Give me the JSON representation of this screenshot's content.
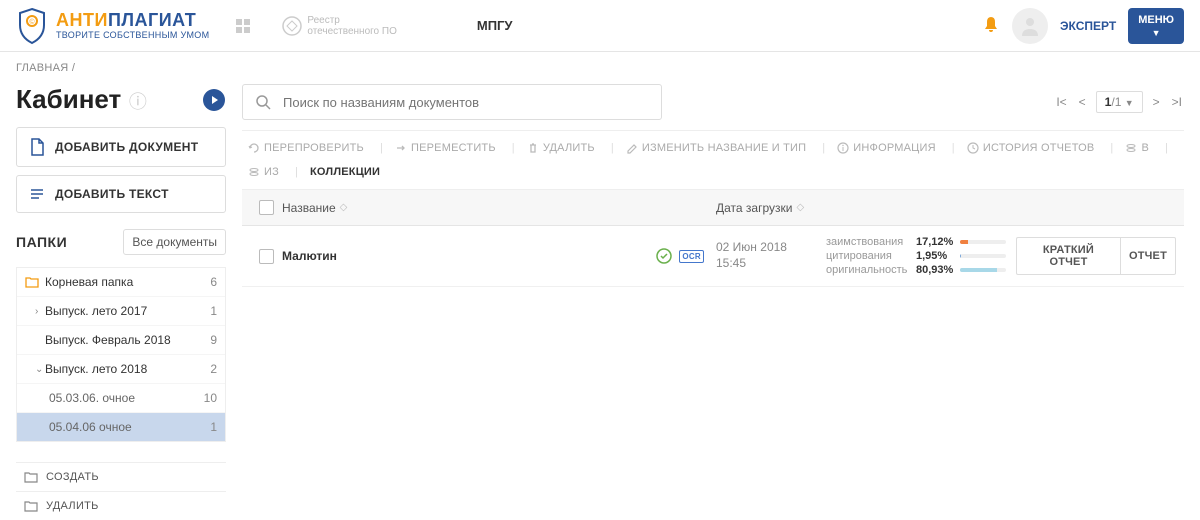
{
  "header": {
    "logo_anti": "АНТИ",
    "logo_plagiat": "ПЛАГИАТ",
    "logo_sub": "ТВОРИТЕ СОБСТВЕННЫМ УМОМ",
    "registry_line1": "Реестр",
    "registry_line2": "отечественного ПО",
    "org": "МПГУ",
    "user_role": "ЭКСПЕРТ",
    "menu_label": "МЕНЮ"
  },
  "breadcrumb": {
    "main": "ГЛАВНАЯ",
    "sep": "/"
  },
  "sidebar": {
    "page_title": "Кабинет",
    "add_doc": "ДОБАВИТЬ ДОКУМЕНТ",
    "add_text": "ДОБАВИТЬ ТЕКСТ",
    "folders_title": "ПАПКИ",
    "all_docs": "Все документы",
    "folders": [
      {
        "label": "Корневая папка",
        "count": "6"
      },
      {
        "label": "Выпуск. лето 2017",
        "count": "1"
      },
      {
        "label": "Выпуск. Февраль 2018",
        "count": "9"
      },
      {
        "label": "Выпуск. лето 2018",
        "count": "2"
      },
      {
        "label": "05.03.06. очное",
        "count": "10"
      },
      {
        "label": "05.04.06 очное",
        "count": "1"
      }
    ],
    "create": "СОЗДАТЬ",
    "delete": "УДАЛИТЬ"
  },
  "search": {
    "placeholder": "Поиск по названиям документов"
  },
  "pagination": {
    "current": "1",
    "total": "/1"
  },
  "toolbar": {
    "recheck": "ПЕРЕПРОВЕРИТЬ",
    "move": "ПЕРЕМЕСТИТЬ",
    "delete": "УДАЛИТЬ",
    "rename": "ИЗМЕНИТЬ НАЗВАНИЕ И ТИП",
    "info": "ИНФОРМАЦИЯ",
    "history": "ИСТОРИЯ ОТЧЕТОВ",
    "in": "В",
    "from": "ИЗ",
    "collections": "КОЛЛЕКЦИИ"
  },
  "table": {
    "col_name": "Название",
    "col_date": "Дата загрузки"
  },
  "rows": [
    {
      "name": "Малютин",
      "ocr": "OCR",
      "date_line1": "02 Июн 2018",
      "date_line2": "15:45",
      "stats": {
        "borrow_label": "заимствования",
        "borrow_val": "17,12%",
        "borrow_color": "#f08040",
        "borrow_pct": 17,
        "cite_label": "цитирования",
        "cite_val": "1,95%",
        "cite_color": "#7aa6d8",
        "cite_pct": 2,
        "orig_label": "оригинальность",
        "orig_val": "80,93%",
        "orig_color": "#a8d8e8",
        "orig_pct": 81
      },
      "short_report": "КРАТКИЙ ОТЧЕТ",
      "report": "ОТЧЕТ"
    }
  ]
}
